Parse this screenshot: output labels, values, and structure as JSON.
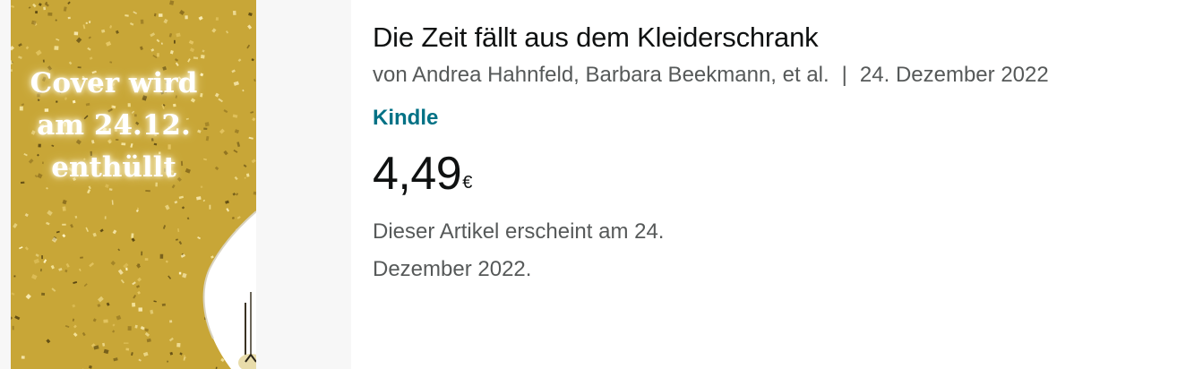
{
  "cover": {
    "text_lines": [
      "Cover wird",
      "am 24.12.",
      "enthüllt"
    ],
    "background_color": "#c8a637",
    "confetti_color": "#f3e29a"
  },
  "product": {
    "title": "Die Zeit fällt aus dem Kleiderschrank",
    "authors": "von Andrea Hahnfeld, Barbara Beekmann, et al.",
    "separator": "|",
    "release_date": "24. Dezember 2022",
    "format": "Kindle",
    "price_whole": "4,49",
    "price_symbol": "€",
    "availability": "Dieser Artikel erscheint am 24. Dezember 2022."
  },
  "colors": {
    "title": "#0f1111",
    "secondary_text": "#565959",
    "link": "#007185"
  }
}
